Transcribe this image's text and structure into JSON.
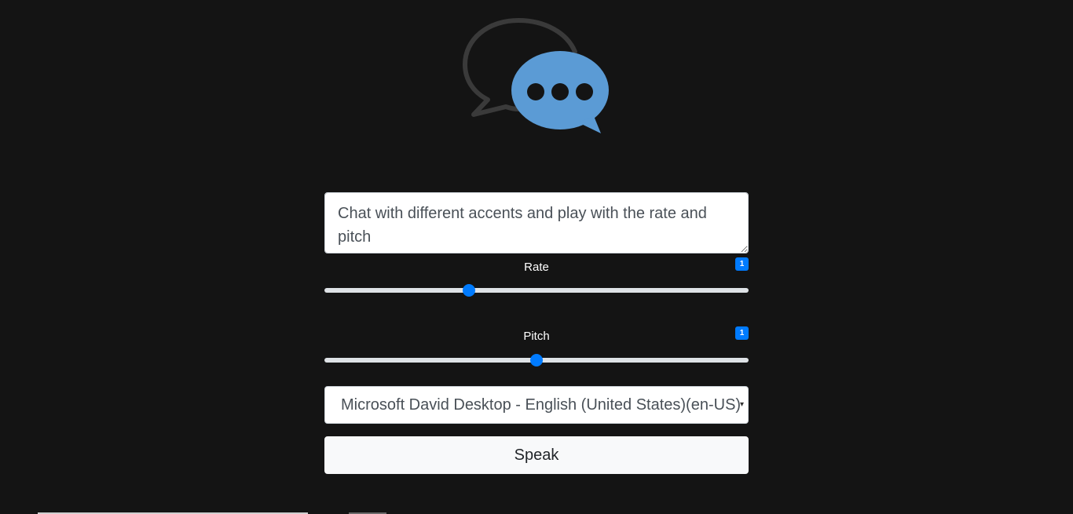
{
  "logo": {
    "icon": "chat-bubbles-icon",
    "colors": {
      "back_bubble": "#3a3a3a",
      "front_bubble": "#5b9bd5",
      "dots": "#141414"
    }
  },
  "text_input": {
    "value": "Chat with different accents and play with the rate and pitch"
  },
  "rate": {
    "label": "Rate",
    "badge": "1",
    "value_fraction": 0.34
  },
  "pitch": {
    "label": "Pitch",
    "badge": "1",
    "value_fraction": 0.5
  },
  "voice_select": {
    "selected": "Microsoft David Desktop - English (United States)(en-US)",
    "arrow": "▾"
  },
  "speak_button": {
    "label": "Speak"
  },
  "colors": {
    "background": "#141414",
    "accent": "#007bff",
    "track": "#dee2e6"
  }
}
